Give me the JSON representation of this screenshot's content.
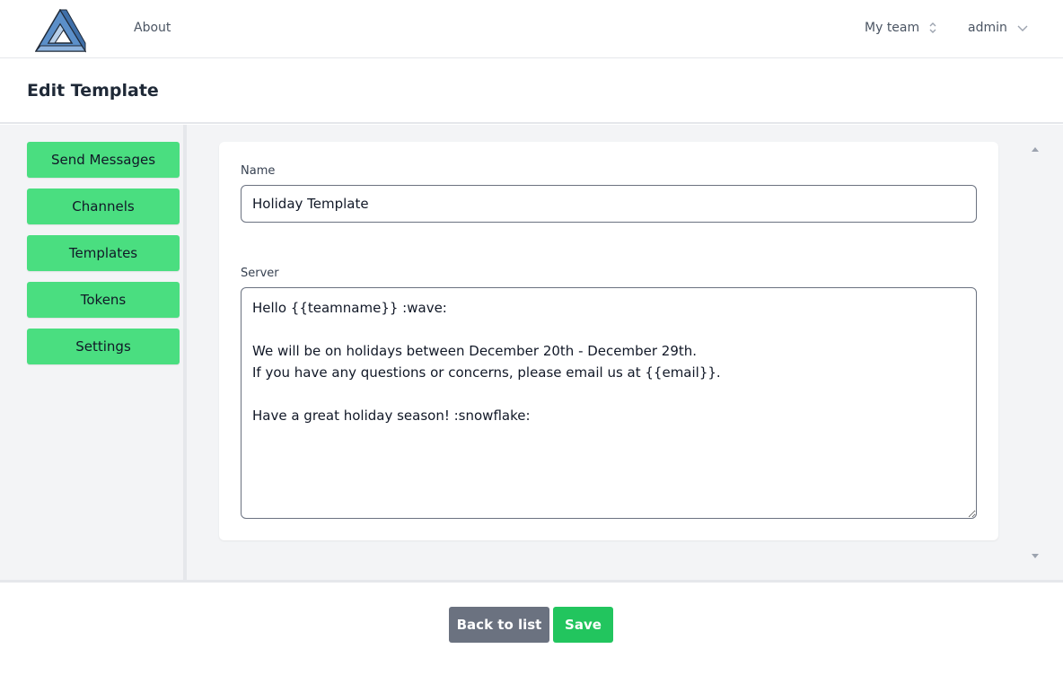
{
  "nav": {
    "about_label": "About",
    "team_label": "My team",
    "user_label": "admin"
  },
  "page": {
    "title": "Edit Template"
  },
  "sidebar": {
    "items": [
      {
        "label": "Send Messages"
      },
      {
        "label": "Channels"
      },
      {
        "label": "Templates"
      },
      {
        "label": "Tokens"
      },
      {
        "label": "Settings"
      }
    ]
  },
  "form": {
    "name_label": "Name",
    "name_value": "Holiday Template",
    "server_label": "Server",
    "server_value": "Hello {{teamname}} :wave:\n\nWe will be on holidays between December 20th - December 29th.\nIf you have any questions or concerns, please email us at {{email}}.\n\nHave a great holiday season! :snowflake:"
  },
  "footer": {
    "back_label": "Back to list",
    "save_label": "Save"
  },
  "colors": {
    "sidebar_button": "#4ade80",
    "save_button": "#22c55e",
    "back_button": "#6b7280",
    "logo_blue": "#5b8fc9"
  },
  "icons": {
    "logo": "impossible-triangle-logo",
    "team_selector": "chevron-up-down-icon",
    "user_menu": "chevron-down-icon"
  }
}
